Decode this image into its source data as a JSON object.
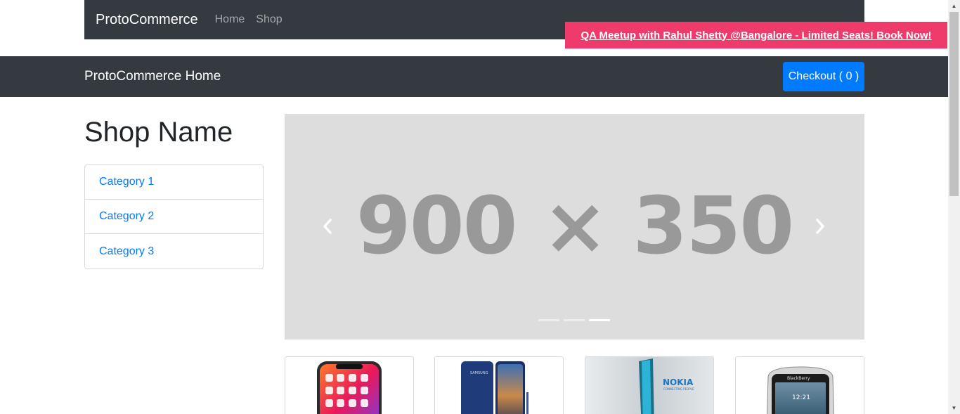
{
  "nav": {
    "brand": "ProtoCommerce",
    "links": [
      "Home",
      "Shop"
    ]
  },
  "promo": {
    "text": "QA Meetup with Rahul Shetty @Bangalore - Limited Seats! Book Now!",
    "color": "#ee3b6b"
  },
  "header": {
    "title": "ProtoCommerce Home",
    "checkout_label": "Checkout ( 0 )"
  },
  "sidebar": {
    "shop_name": "Shop Name",
    "categories": [
      "Category 1",
      "Category 2",
      "Category 3"
    ]
  },
  "carousel": {
    "placeholder_text": "900 × 350",
    "prev_icon": "chevron-left-icon",
    "next_icon": "chevron-right-icon",
    "indicator_count": 3,
    "active_indicator": 3
  },
  "products": [
    {
      "image": "iphone-x-image"
    },
    {
      "image": "samsung-note-8-image"
    },
    {
      "image": "nokia-edge-image"
    },
    {
      "image": "blackberry-image"
    }
  ],
  "colors": {
    "navbar": "#343a40",
    "primary": "#007bff",
    "carousel_bg": "#dddddd"
  }
}
